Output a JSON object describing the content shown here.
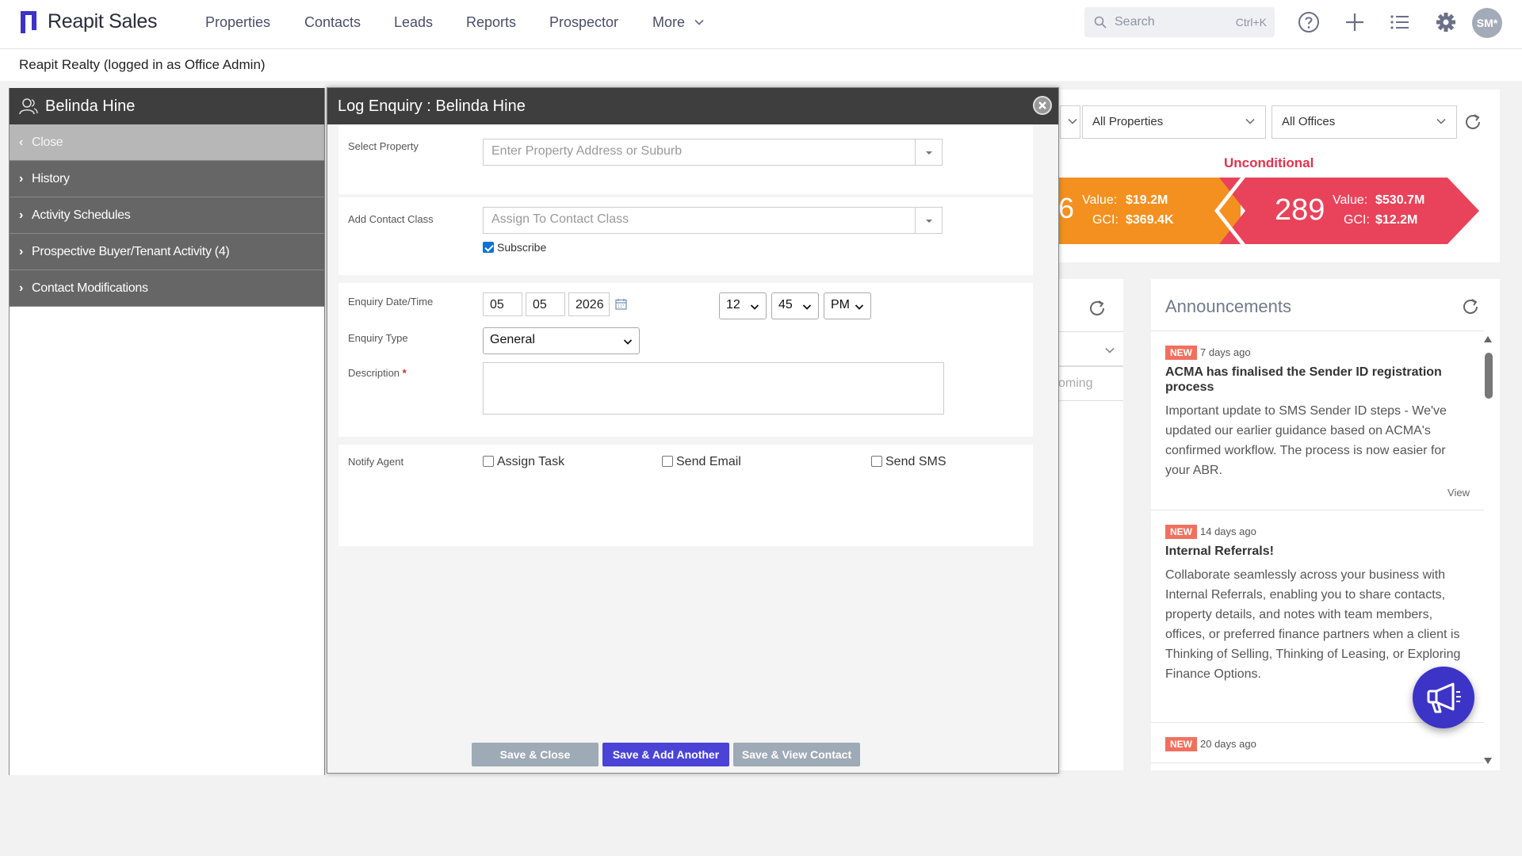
{
  "app": {
    "brand": "Reapit Sales"
  },
  "nav": [
    "Properties",
    "Contacts",
    "Leads",
    "Reports",
    "Prospector",
    "More"
  ],
  "search": {
    "placeholder": "Search",
    "shortcut": "Ctrl+K"
  },
  "user": {
    "initials": "SM*"
  },
  "company_line": "Reapit Realty (logged in as Office Admin)",
  "contact_panel": {
    "name": "Belinda Hine",
    "items": [
      "Close",
      "History",
      "Activity Schedules",
      "Prospective Buyer/Tenant Activity (4)",
      "Contact Modifications"
    ]
  },
  "modal": {
    "title": "Log Enquiry : Belinda Hine",
    "select_property": {
      "label": "Select Property",
      "placeholder": "Enter Property Address or Suburb"
    },
    "contact_class": {
      "label": "Add Contact Class",
      "placeholder": "Assign To Contact Class",
      "subscribe_label": "Subscribe",
      "subscribe_checked": true
    },
    "enquiry_date": {
      "label": "Enquiry Date/Time",
      "day": "05",
      "month": "05",
      "year": "2026",
      "hour": "12",
      "minute": "45",
      "ampm": "PM"
    },
    "enquiry_type": {
      "label": "Enquiry Type",
      "value": "General"
    },
    "description": {
      "label": "Description",
      "required_mark": "*",
      "value": ""
    },
    "notify": {
      "label": "Notify Agent",
      "assign_task": "Assign Task",
      "send_email": "Send Email",
      "send_sms": "Send SMS"
    },
    "buttons": {
      "save_close": "Save & Close",
      "save_add": "Save & Add Another",
      "save_view": "Save & View Contact"
    }
  },
  "dashboard": {
    "filter_properties": "All Properties",
    "filter_offices": "All Offices",
    "stage_label": "Unconditional",
    "orange_count_partial": "6",
    "orange": {
      "value_label": "Value:",
      "value": "$19.2M",
      "gci_label": "GCI:",
      "gci": "$369.4K"
    },
    "red": {
      "count": "289",
      "value_label": "Value:",
      "value": "$530.7M",
      "gci_label": "GCI:",
      "gci": "$12.2M"
    },
    "upcoming_partial": "oming"
  },
  "announcements": {
    "title": "Announcements",
    "items": [
      {
        "badge": "NEW",
        "when": "7 days ago",
        "title": "ACMA has finalised the Sender ID registration process",
        "body": "Important update to SMS Sender ID steps - We've updated our earlier guidance based on ACMA's confirmed workflow. The process is now easier for your ABR.",
        "view": "View"
      },
      {
        "badge": "NEW",
        "when": "14 days ago",
        "title": "Internal Referrals!",
        "body": "Collaborate seamlessly across your business with Internal Referrals, enabling you to share contacts, property details, and notes with team members, offices, or preferred finance partners when a client is Thinking of Selling, Thinking of Leasing, or Exploring Finance Options.",
        "view": ""
      },
      {
        "badge": "NEW",
        "when": "20 days ago",
        "title": "",
        "body": "",
        "view": ""
      }
    ]
  },
  "colors": {
    "brand": "#3c33c7",
    "orange": "#f4901f",
    "red": "#e8435a",
    "dark_header": "#3e3e3e"
  }
}
